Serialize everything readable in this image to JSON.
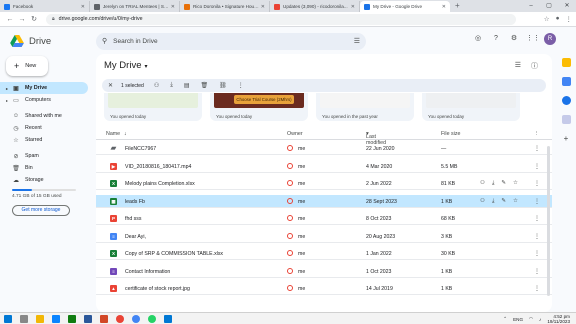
{
  "browser": {
    "tabs": [
      {
        "label": "Facebook",
        "color": "#1877f2",
        "active": false
      },
      {
        "label": "Jerelyn on TRIAL Mentees | Sw...",
        "color": "#5f6368",
        "active": false
      },
      {
        "label": "Rico Doronila • Signature Hous...",
        "color": "#e8710a",
        "active": false
      },
      {
        "label": "Updates (3,090) - ricodoronila...",
        "color": "#ea4335",
        "active": false
      },
      {
        "label": "My Drive - Google Drive",
        "color": "#1a73e8",
        "active": true
      }
    ],
    "url": "drive.google.com/drive/u/0/my-drive"
  },
  "header": {
    "app_name": "Drive",
    "search_placeholder": "Search in Drive",
    "avatar_letter": "R"
  },
  "sidebar": {
    "new_label": "New",
    "items": [
      {
        "label": "My Drive",
        "icon": "my-drive-icon",
        "glyph": "▣",
        "active": true,
        "arrow": true
      },
      {
        "label": "Computers",
        "icon": "computer-icon",
        "glyph": "▭",
        "active": false,
        "arrow": true
      },
      {
        "label": "Shared with me",
        "icon": "shared-icon",
        "glyph": "☺",
        "active": false,
        "arrow": false
      },
      {
        "label": "Recent",
        "icon": "clock-icon",
        "glyph": "◷",
        "active": false,
        "arrow": false
      },
      {
        "label": "Starred",
        "icon": "star-icon",
        "glyph": "☆",
        "active": false,
        "arrow": false
      },
      {
        "label": "Spam",
        "icon": "spam-icon",
        "glyph": "⊘",
        "active": false,
        "arrow": false
      },
      {
        "label": "Bin",
        "icon": "bin-icon",
        "glyph": "🗑",
        "active": false,
        "arrow": false
      },
      {
        "label": "Storage",
        "icon": "cloud-icon",
        "glyph": "☁",
        "active": false,
        "arrow": false
      }
    ],
    "storage_text": "4.71 GB of 15 GB used",
    "storage_used_fraction": 0.314,
    "get_more_label": "Get more storage"
  },
  "main": {
    "title": "My Drive",
    "selection_count": "1 selected",
    "suggestions": [
      {
        "caption": "You opened today",
        "banner": ""
      },
      {
        "caption": "You opened today",
        "banner": "Choose Trial Course (2Mhrs)"
      },
      {
        "caption": "You opened in the past year",
        "banner": ""
      },
      {
        "caption": "You opened today",
        "banner": ""
      }
    ],
    "columns": {
      "name": "Name",
      "owner": "Owner",
      "modified": "Last modified",
      "size": "File size"
    },
    "files": [
      {
        "name": "FileNCC7967",
        "type": "folder",
        "owner": "me",
        "modified": "22 Jun 2020",
        "size": "—",
        "selected": false,
        "hover": false
      },
      {
        "name": "VID_20180816_180417.mp4",
        "type": "video",
        "owner": "me",
        "modified": "4 Mar 2020",
        "size": "5.5 MB",
        "selected": false,
        "hover": false
      },
      {
        "name": "Melody plains Completion.xlsx",
        "type": "excel",
        "owner": "me",
        "modified": "2 Jun 2022",
        "size": "81 KB",
        "selected": false,
        "hover": true
      },
      {
        "name": "leads Fb",
        "type": "sheets",
        "owner": "me",
        "modified": "28 Sept 2023",
        "size": "1 KB",
        "selected": true,
        "hover": false
      },
      {
        "name": "fhd sss",
        "type": "pdf",
        "owner": "me",
        "modified": "8 Oct 2023",
        "size": "68 KB",
        "selected": false,
        "hover": false
      },
      {
        "name": "Dear Ayi,",
        "type": "docs",
        "owner": "me",
        "modified": "20 Aug 2023",
        "size": "3 KB",
        "selected": false,
        "hover": false
      },
      {
        "name": "Copy of SRP & COMMISSION TABLE.xlsx",
        "type": "excel",
        "owner": "me",
        "modified": "1 Jan 2022",
        "size": "30 KB",
        "selected": false,
        "hover": false
      },
      {
        "name": "Contact Information",
        "type": "forms",
        "owner": "me",
        "modified": "1 Oct 2023",
        "size": "1 KB",
        "selected": false,
        "hover": false
      },
      {
        "name": "certificate of stock report.jpg",
        "type": "image",
        "owner": "me",
        "modified": "14 Jul 2019",
        "size": "1 KB",
        "selected": false,
        "hover": false
      }
    ]
  },
  "taskbar": {
    "lang": "ENG",
    "time": "4:52 pm",
    "date": "19/11/2023"
  },
  "colors": {
    "accent": "#0b57d0",
    "selected_row": "#c2e7ff",
    "folder": "#5f6368",
    "video": "#ea4335",
    "excel": "#188038",
    "sheets": "#188038",
    "pdf": "#ea4335",
    "docs": "#4285f4",
    "forms": "#7248b9",
    "image": "#ea4335"
  }
}
